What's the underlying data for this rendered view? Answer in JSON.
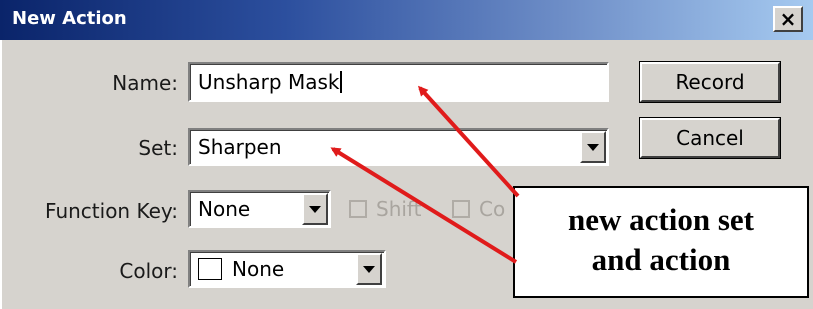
{
  "window": {
    "title": "New Action",
    "close_label": "×"
  },
  "form": {
    "name_label": "Name:",
    "name_value": "Unsharp Mask",
    "set_label": "Set:",
    "set_value": "Sharpen",
    "function_key_label": "Function Key:",
    "function_key_value": "None",
    "shift_label": "Shift",
    "ctrl_label": "Co",
    "color_label": "Color:",
    "color_value": "None"
  },
  "buttons": {
    "record_label": "Record",
    "cancel_label": "Cancel"
  },
  "annotation": {
    "line1": "new action set",
    "line2": "and action",
    "arrow_color": "#e01b1b"
  }
}
